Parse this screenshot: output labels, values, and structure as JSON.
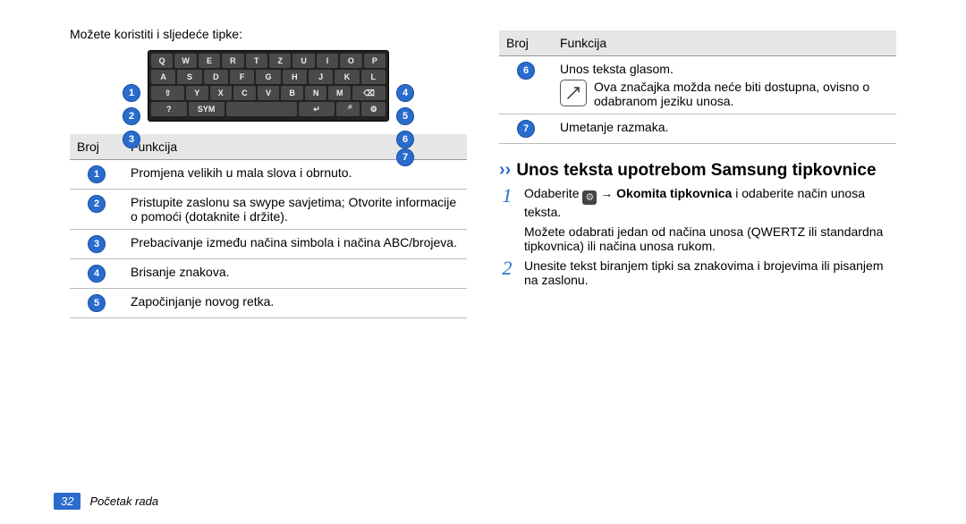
{
  "left": {
    "intro": "Možete koristiti i sljedeće tipke:",
    "keyboard_rows": [
      [
        "Q",
        "W",
        "E",
        "R",
        "T",
        "Z",
        "U",
        "I",
        "O",
        "P"
      ],
      [
        "A",
        "S",
        "D",
        "F",
        "G",
        "H",
        "J",
        "K",
        "L"
      ],
      [
        "⇧",
        "Y",
        "X",
        "C",
        "V",
        "B",
        "N",
        "M",
        "⌫"
      ],
      [
        "?",
        "SYM",
        "␣",
        "↵",
        "🎤",
        "⚙"
      ]
    ],
    "table_head": {
      "col1": "Broj",
      "col2": "Funkcija"
    },
    "rows": [
      {
        "n": "1",
        "text": "Promjena velikih u mala slova i obrnuto."
      },
      {
        "n": "2",
        "text": "Pristupite zaslonu sa swype savjetima; Otvorite informacije o pomoći (dotaknite i držite)."
      },
      {
        "n": "3",
        "text": "Prebacivanje između načina simbola i načina ABC/brojeva."
      },
      {
        "n": "4",
        "text": "Brisanje znakova."
      },
      {
        "n": "5",
        "text": "Započinjanje novog retka."
      }
    ]
  },
  "right": {
    "table_head": {
      "col1": "Broj",
      "col2": "Funkcija"
    },
    "rows": [
      {
        "n": "6",
        "text_main": "Unos teksta glasom.",
        "note": "Ova značajka možda neće biti dostupna, ovisno o odabranom jeziku unosa."
      },
      {
        "n": "7",
        "text_main": "Umetanje razmaka."
      }
    ],
    "heading": "Unos teksta upotrebom Samsung tipkovnice",
    "steps": [
      {
        "num": "1",
        "pre": "Odaberite ",
        "arrow": " → ",
        "bold": "Okomita tipkovnica",
        "post": " i odaberite način unosa teksta.",
        "sub": "Možete odabrati jedan od načina unosa (QWERTZ ili standardna tipkovnica) ili načina unosa rukom."
      },
      {
        "num": "2",
        "text": "Unesite tekst biranjem tipki sa znakovima i brojevima ili pisanjem na zaslonu."
      }
    ]
  },
  "footer": {
    "page": "32",
    "section": "Početak rada"
  }
}
